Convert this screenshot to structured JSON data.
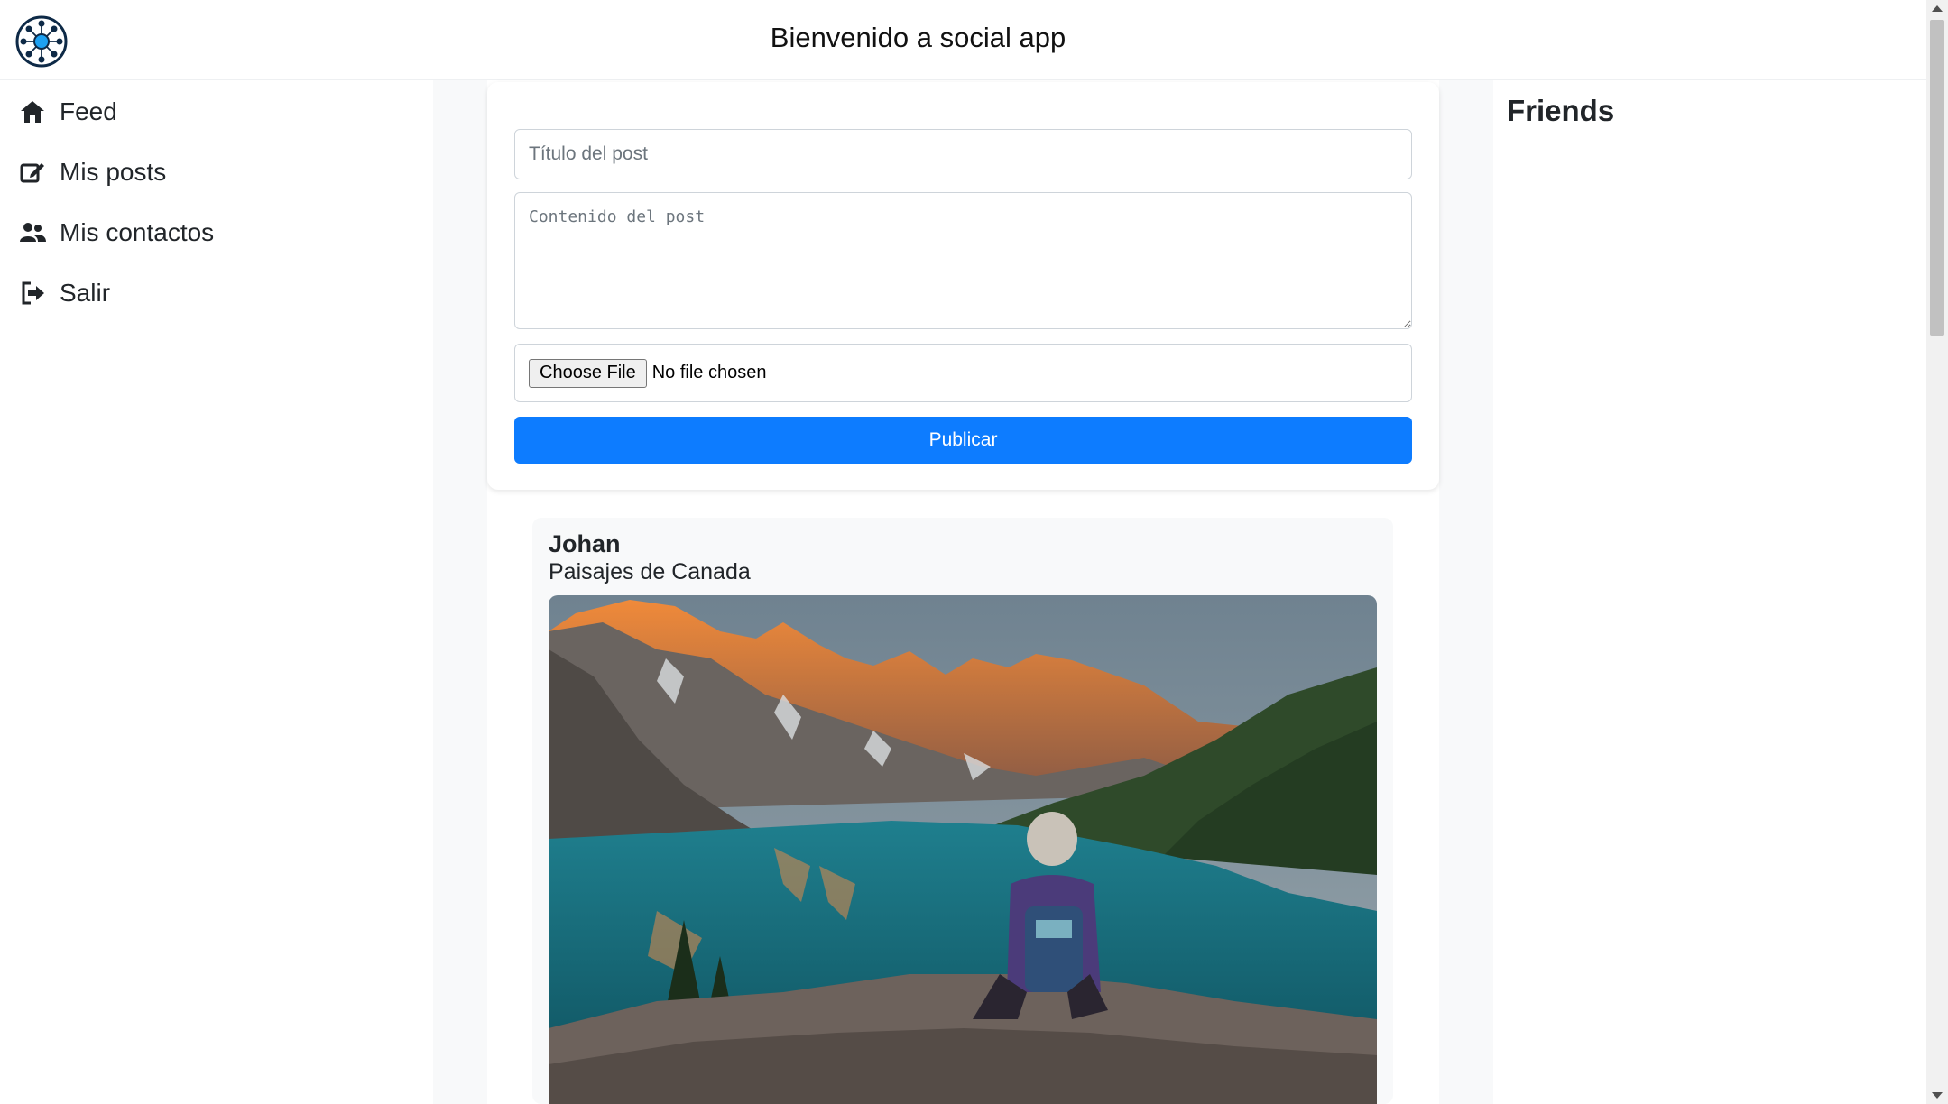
{
  "header": {
    "title": "Bienvenido a social app",
    "logo_icon": "network-logo-icon"
  },
  "sidebar": {
    "items": [
      {
        "label": "Feed",
        "icon": "home-icon"
      },
      {
        "label": "Mis posts",
        "icon": "edit-icon"
      },
      {
        "label": "Mis contactos",
        "icon": "users-icon"
      },
      {
        "label": "Salir",
        "icon": "sign-out-icon"
      }
    ]
  },
  "form": {
    "title_placeholder": "Título del post",
    "content_placeholder": "Contenido del post",
    "file_button": "Choose File",
    "file_status": "No file chosen",
    "submit_label": "Publicar"
  },
  "posts": [
    {
      "author": "Johan",
      "title": "Paisajes de Canada",
      "image": "mountain-lake-hiker-photo"
    }
  ],
  "right_panel": {
    "title": "Friends"
  },
  "colors": {
    "primary": "#0d7cff",
    "background_light": "#f8f9fa",
    "text": "#212529"
  }
}
